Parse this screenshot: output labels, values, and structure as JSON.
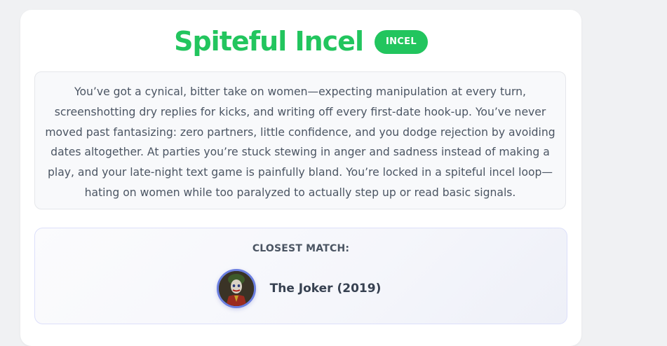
{
  "result": {
    "title": "Spiteful Incel",
    "badge": "INCEL",
    "description": "You’ve got a cynical, bitter take on women—expecting manipulation at every turn, screenshotting dry replies for kicks, and writing off every first-date hook-up. You’ve never moved past fantasizing: zero partners, little confidence, and you dodge rejection by avoiding dates altogether. At parties you’re stuck stewing in anger and sadness instead of making a play, and your late-night text game is painfully bland. You’re locked in a spiteful incel loop—hating on women while too paralyzed to actually step up or read basic signals."
  },
  "closest_match": {
    "label": "CLOSEST MATCH:",
    "name": "The Joker (2019)",
    "avatar_icon": "joker-portrait"
  },
  "colors": {
    "accent": "#22c55e",
    "avatar_ring": "#6b7fe0",
    "page_background": "#f0f1f3"
  }
}
